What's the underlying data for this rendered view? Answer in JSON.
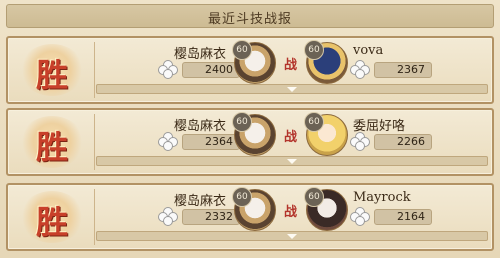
{
  "header": {
    "title": "最近斗技战报"
  },
  "records": [
    {
      "result": "胜",
      "left": {
        "name": "樱岛麻衣",
        "score": "2400",
        "level": "60"
      },
      "vs": "战",
      "right": {
        "name": "vova",
        "score": "2367",
        "level": "60"
      },
      "colors": {
        "avatar_right": "#2b3f7a"
      }
    },
    {
      "result": "胜",
      "left": {
        "name": "樱岛麻衣",
        "score": "2364",
        "level": "60"
      },
      "vs": "战",
      "right": {
        "name": "委屈好咯",
        "score": "2266",
        "level": "60"
      },
      "colors": {
        "avatar_right": "#f2d16b"
      }
    },
    {
      "result": "胜",
      "left": {
        "name": "樱岛麻衣",
        "score": "2332",
        "level": "60"
      },
      "vs": "战",
      "right": {
        "name": "Mayrock",
        "score": "2164",
        "level": "60"
      },
      "colors": {
        "avatar_right": "#3a2a26"
      }
    }
  ],
  "icons": {
    "score": "flower-icon",
    "expand": "chevron-down-icon"
  }
}
